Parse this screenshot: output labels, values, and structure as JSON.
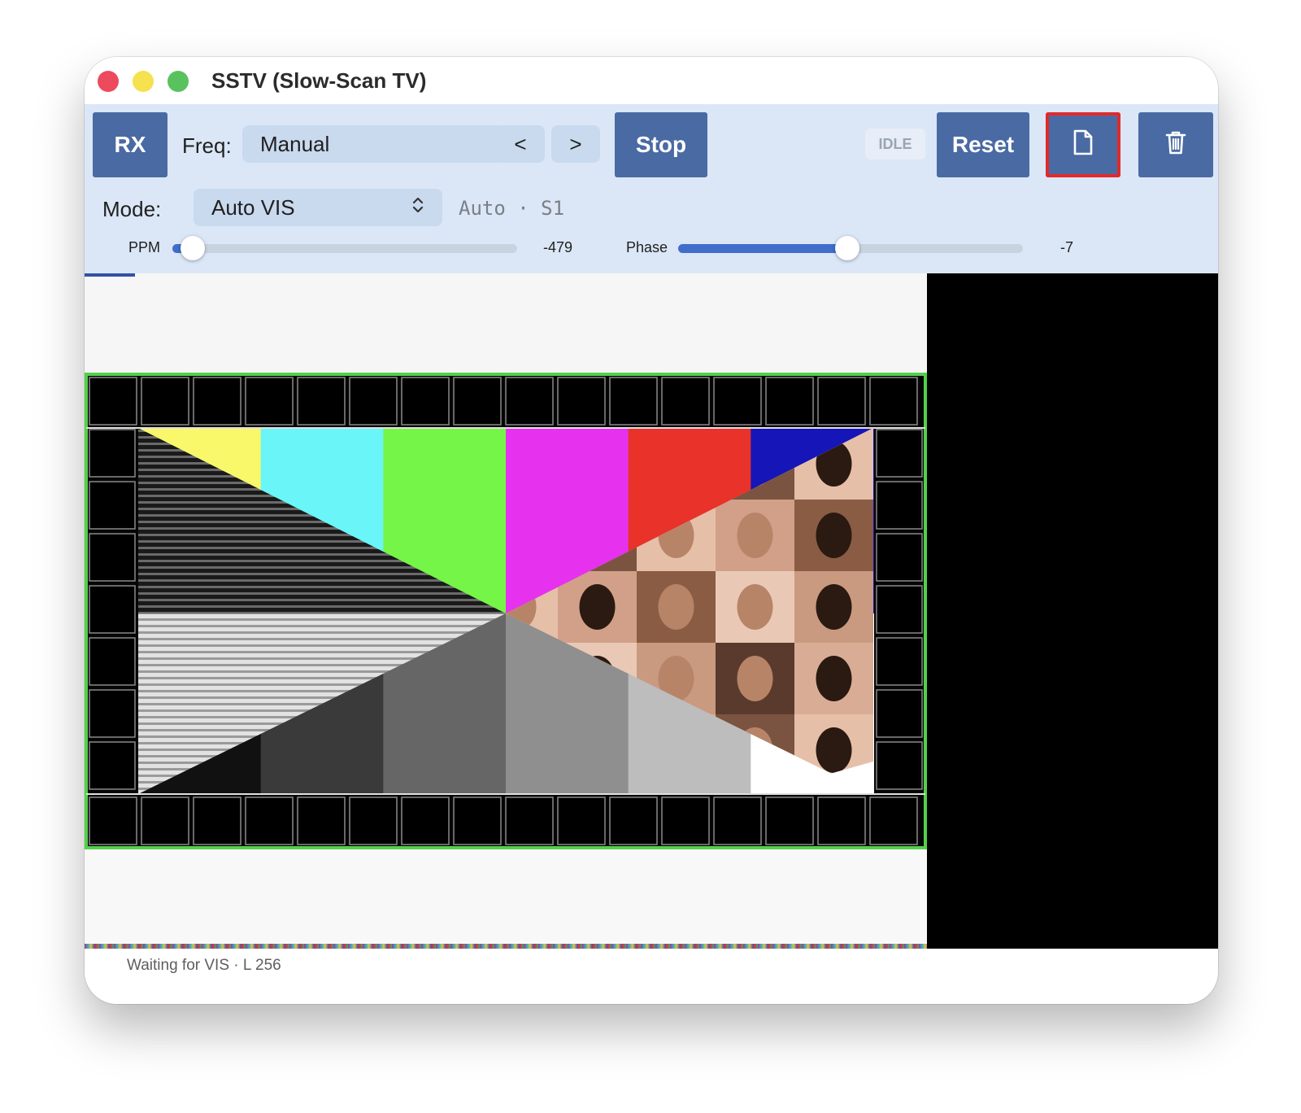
{
  "window": {
    "title": "SSTV (Slow-Scan TV)"
  },
  "toolbar": {
    "rx_label": "RX",
    "freq_label": "Freq:",
    "freq_value": "Manual",
    "prev_label": "<",
    "next_label": ">",
    "stop_label": "Stop",
    "status_badge": "IDLE",
    "reset_label": "Reset",
    "mode_label": "Mode:",
    "mode_value": "Auto VIS",
    "mode_status": "Auto · S1"
  },
  "sliders": {
    "ppm": {
      "label": "PPM",
      "value": "-479",
      "fraction": 0.06
    },
    "phase": {
      "label": "Phase",
      "value": "-7",
      "fraction": 0.49
    }
  },
  "icons": {
    "file": "document-icon",
    "trash": "trash-icon",
    "select_chevron": "chevron-updown-icon"
  },
  "colors": {
    "accent": "#4a6aa4",
    "toolbar_bg": "#dbe7f7",
    "slider_fill": "#3f6fcb",
    "highlight_border": "#e02a2a"
  },
  "image": {
    "color_bars": [
      "#f8f86a",
      "#6af5f8",
      "#75f548",
      "#e632ee",
      "#e8322a",
      "#1515b8"
    ],
    "gray_bars": [
      "#111111",
      "#3a3a3a",
      "#666666",
      "#8f8f8f",
      "#bdbdbd",
      "#ffffff"
    ]
  },
  "status": {
    "text": "Waiting for VIS · L 256"
  }
}
